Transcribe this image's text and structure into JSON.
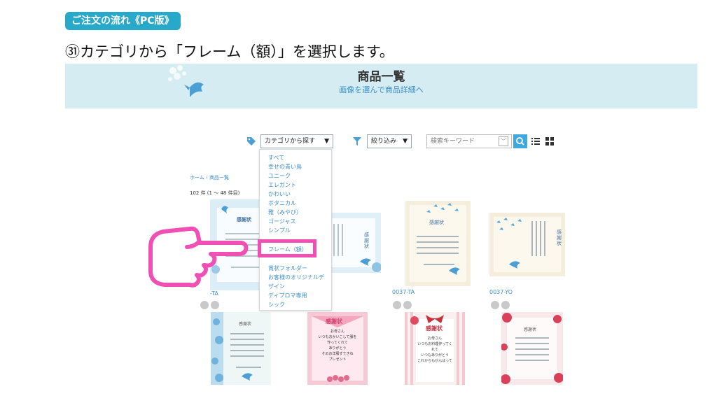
{
  "badge": "ご注文の流れ《PC版》",
  "instruction": "㉛カテゴリから「フレーム（額）」を選択します。",
  "banner": {
    "title": "商品一覧",
    "subtitle": "画像を選んで商品詳細へ"
  },
  "toolbar": {
    "category_select": "カテゴリから探す",
    "filter_select": "絞り込み",
    "search_placeholder": "検索キーワード"
  },
  "breadcrumb": "ホーム › 商品一覧",
  "count": "102 件 (1 ～ 48 件目)",
  "dropdown_items": [
    "すべて",
    "幸せの青い鳥",
    "ユニーク",
    "エレガント",
    "かわいい",
    "ボタニカル",
    "雅（みやび）",
    "ゴージャス",
    "シンプル",
    "フレーム（額）",
    "賞状フォルダー",
    "お客様のオリジナルデ",
    "ザイン",
    "ディプロマ専用",
    "シック"
  ],
  "cards": [
    {
      "code": "-TA",
      "title": "感謝状"
    },
    {
      "code": "",
      "title": "感謝状"
    },
    {
      "code": "0037-TA",
      "title": "感謝状"
    },
    {
      "code": "0037-YO",
      "title": "感謝状"
    },
    {
      "title": "感謝状"
    },
    {
      "title": "感謝状",
      "body": [
        "お母さん",
        "いつもおかいこして服を",
        "作ってくれて",
        "ありがとう",
        "そのお洋服すてきね",
        "プレゼント"
      ]
    },
    {
      "title": "感謝状",
      "body": [
        "お母さん",
        "いつもお料理作ってくれて",
        "いつもありがとう",
        "これからもがんばって"
      ]
    },
    {
      "title": "感謝状"
    }
  ],
  "colors": {
    "accent": "#29a9c9",
    "link": "#3c8fc9",
    "highlight": "#f050b4",
    "banner_bg": "#d4ecf2"
  }
}
